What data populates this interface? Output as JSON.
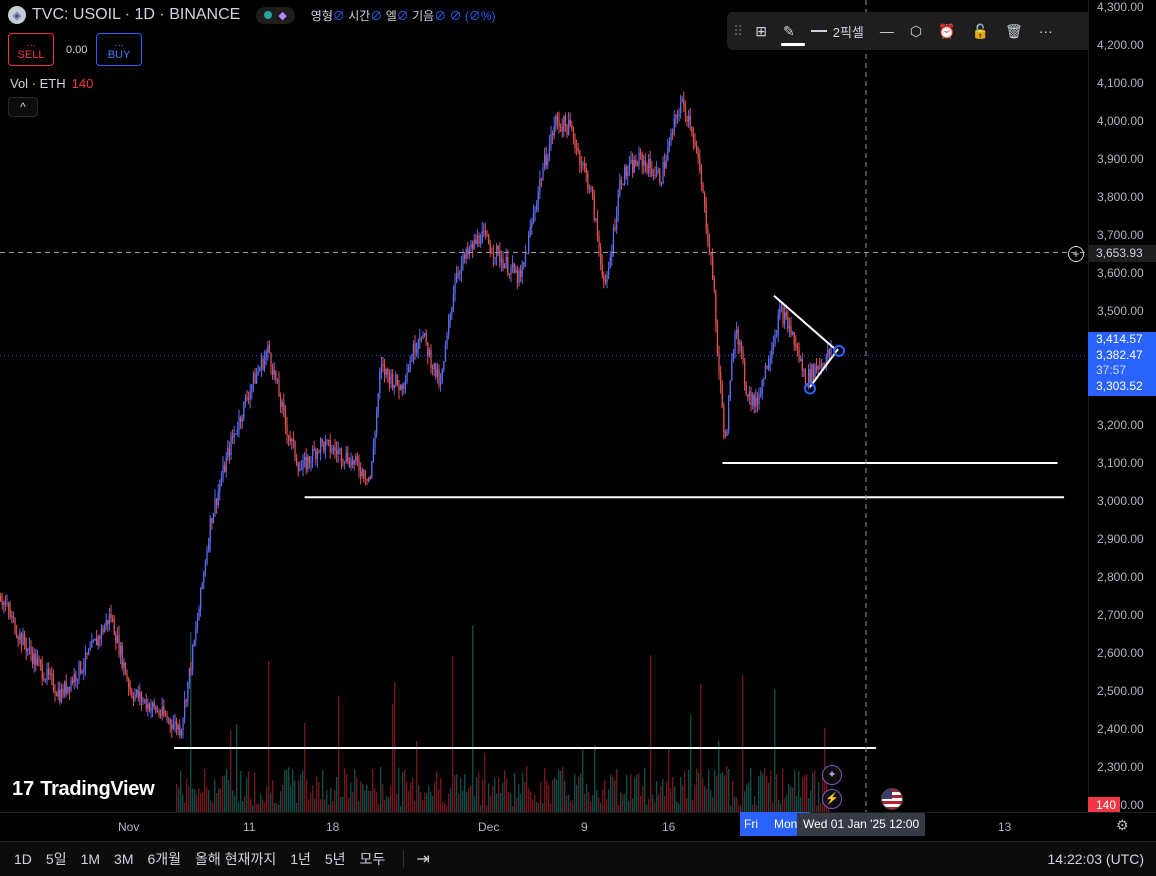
{
  "legend": {
    "symbol_title": "TVC: USOIL · 1D · BINANCE",
    "logo_glyph": "◈",
    "ohlc_labels": [
      "영형",
      "시간",
      "엘",
      "기음"
    ],
    "ohlc_blank": "∅",
    "change": "∅ (∅%)"
  },
  "trade": {
    "sell_dots": "...",
    "sell_label": "SELL",
    "spread": "0.00",
    "buy_dots": "...",
    "buy_label": "BUY"
  },
  "volume_legend": {
    "label": "Vol · ETH",
    "value": "140"
  },
  "collapse_icon": "^",
  "toolbar": {
    "grip_icon": "⠿",
    "layout_icon": "⊞",
    "pen_icon": "✎",
    "line_width_label": "2픽셀",
    "line_style_icon": "—",
    "settings_icon": "⬡",
    "alert_icon": "⏰",
    "lock_icon": "🔓",
    "trash_icon": "🗑",
    "more_icon": "···"
  },
  "price_axis": {
    "ticks": [
      "4,300.00",
      "4,200.00",
      "4,100.00",
      "4,000.00",
      "3,900.00",
      "3,800.00",
      "3,700.00",
      "3,600.00",
      "3,500.00",
      "3,400.00",
      "3,300.00",
      "3,200.00",
      "3,100.00",
      "3,000.00",
      "2,900.00",
      "2,800.00",
      "2,700.00",
      "2,600.00",
      "2,500.00",
      "2,400.00",
      "2,300.00",
      "2,200.00"
    ],
    "crosshair_price": "3,653.93",
    "high_label": "3,414.57",
    "last_price": "3,382.47",
    "countdown": "37:57",
    "low_label": "3,303.52",
    "volume_label": "140"
  },
  "time_axis": {
    "ticks": [
      "Nov",
      "11",
      "18",
      "Dec",
      "9",
      "16",
      "13"
    ],
    "highlight_fri": "Fri",
    "highlight_mon": "Mon",
    "crosshair_time": "Wed 01 Jan '25   12:00"
  },
  "bottom_bar": {
    "ranges": [
      "1D",
      "5일",
      "1M",
      "3M",
      "6개월",
      "올해 현재까지",
      "1년",
      "5년",
      "모두"
    ],
    "date_range_icon": "⇥",
    "clock": "14:22:03 (UTC)"
  },
  "watermark": {
    "mark": "17",
    "text": "TradingView"
  },
  "side_buttons": {
    "ai_icon": "✦",
    "flash_icon": "⚡"
  },
  "colors": {
    "up": "#26a69a",
    "down": "#f23645",
    "accent": "#2962ff",
    "candle_blue": "#5b6cf0",
    "candle_red": "#e05050"
  },
  "chart_data": {
    "type": "candlestick",
    "price_range": [
      2200,
      4300
    ],
    "series_note": "USOIL 1D price with hourly-style wicks",
    "anchors": [
      [
        0,
        2750
      ],
      [
        20,
        2640
      ],
      [
        40,
        2560
      ],
      [
        60,
        2490
      ],
      [
        85,
        2580
      ],
      [
        110,
        2700
      ],
      [
        130,
        2500
      ],
      [
        160,
        2440
      ],
      [
        180,
        2400
      ],
      [
        195,
        2650
      ],
      [
        210,
        2950
      ],
      [
        230,
        3150
      ],
      [
        250,
        3300
      ],
      [
        268,
        3400
      ],
      [
        285,
        3200
      ],
      [
        300,
        3080
      ],
      [
        320,
        3150
      ],
      [
        345,
        3120
      ],
      [
        370,
        3060
      ],
      [
        380,
        3350
      ],
      [
        400,
        3300
      ],
      [
        420,
        3450
      ],
      [
        440,
        3300
      ],
      [
        455,
        3600
      ],
      [
        480,
        3700
      ],
      [
        500,
        3640
      ],
      [
        520,
        3580
      ],
      [
        540,
        3850
      ],
      [
        555,
        4000
      ],
      [
        570,
        3980
      ],
      [
        590,
        3820
      ],
      [
        605,
        3550
      ],
      [
        620,
        3850
      ],
      [
        640,
        3900
      ],
      [
        660,
        3850
      ],
      [
        680,
        4050
      ],
      [
        690,
        4000
      ],
      [
        700,
        3850
      ],
      [
        712,
        3600
      ],
      [
        718,
        3350
      ],
      [
        725,
        3150
      ],
      [
        735,
        3480
      ],
      [
        745,
        3300
      ],
      [
        755,
        3250
      ],
      [
        770,
        3400
      ],
      [
        780,
        3500
      ],
      [
        790,
        3450
      ],
      [
        805,
        3320
      ],
      [
        815,
        3350
      ],
      [
        830,
        3390
      ]
    ],
    "horizontal_levels": [
      {
        "price": 3100,
        "x_start_frac": 0.664,
        "x_end_frac": 0.972
      },
      {
        "price": 3010,
        "x_start_frac": 0.28,
        "x_end_frac": 0.978
      },
      {
        "price": 2350,
        "x_start_frac": 0.16,
        "x_end_frac": 0.805
      }
    ]
  }
}
